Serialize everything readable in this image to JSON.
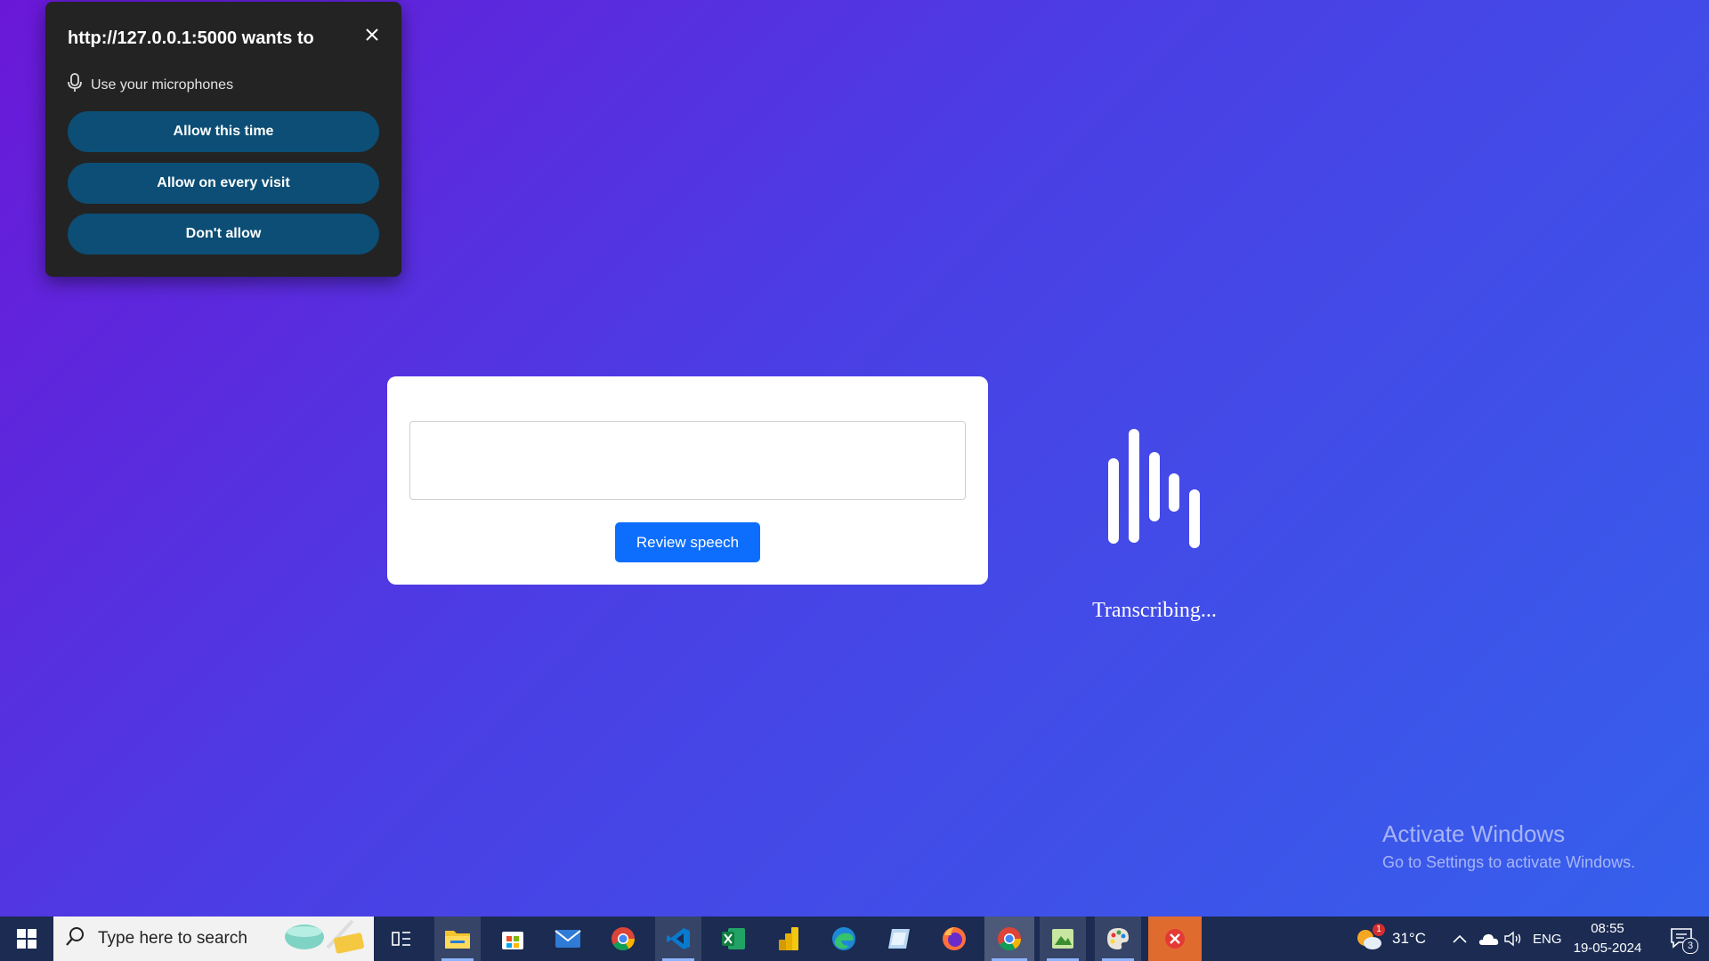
{
  "popup": {
    "title": "http://127.0.0.1:5000 wants to",
    "permission": "Use your microphones",
    "buttons": [
      "Allow this time",
      "Allow on every visit",
      "Don't allow"
    ]
  },
  "card": {
    "textarea_value": "",
    "review_button": "Review speech"
  },
  "status": "Transcribing...",
  "watermark": {
    "line1": "Activate Windows",
    "line2": "Go to Settings to activate Windows."
  },
  "taskbar": {
    "search_placeholder": "Type here to search",
    "apps": [
      "start-icon",
      "task-view-icon",
      "file-explorer-icon",
      "store-icon",
      "mail-icon",
      "chrome-icon",
      "vscode-icon",
      "excel-icon",
      "powerbi-icon",
      "edge-icon",
      "app-icon",
      "firefox-icon",
      "chrome-icon",
      "app-icon",
      "paint-icon",
      "close-app-icon"
    ],
    "weather_temp": "31°C",
    "language": "ENG",
    "time": "08:55",
    "date": "19-05-2024",
    "notification_count": "3",
    "weather_badge": "1"
  },
  "colors": {
    "background_start": "#6a18d8",
    "background_end": "#3560ec",
    "popup_button": "#0c4e75",
    "primary_button": "#0d6efd"
  }
}
